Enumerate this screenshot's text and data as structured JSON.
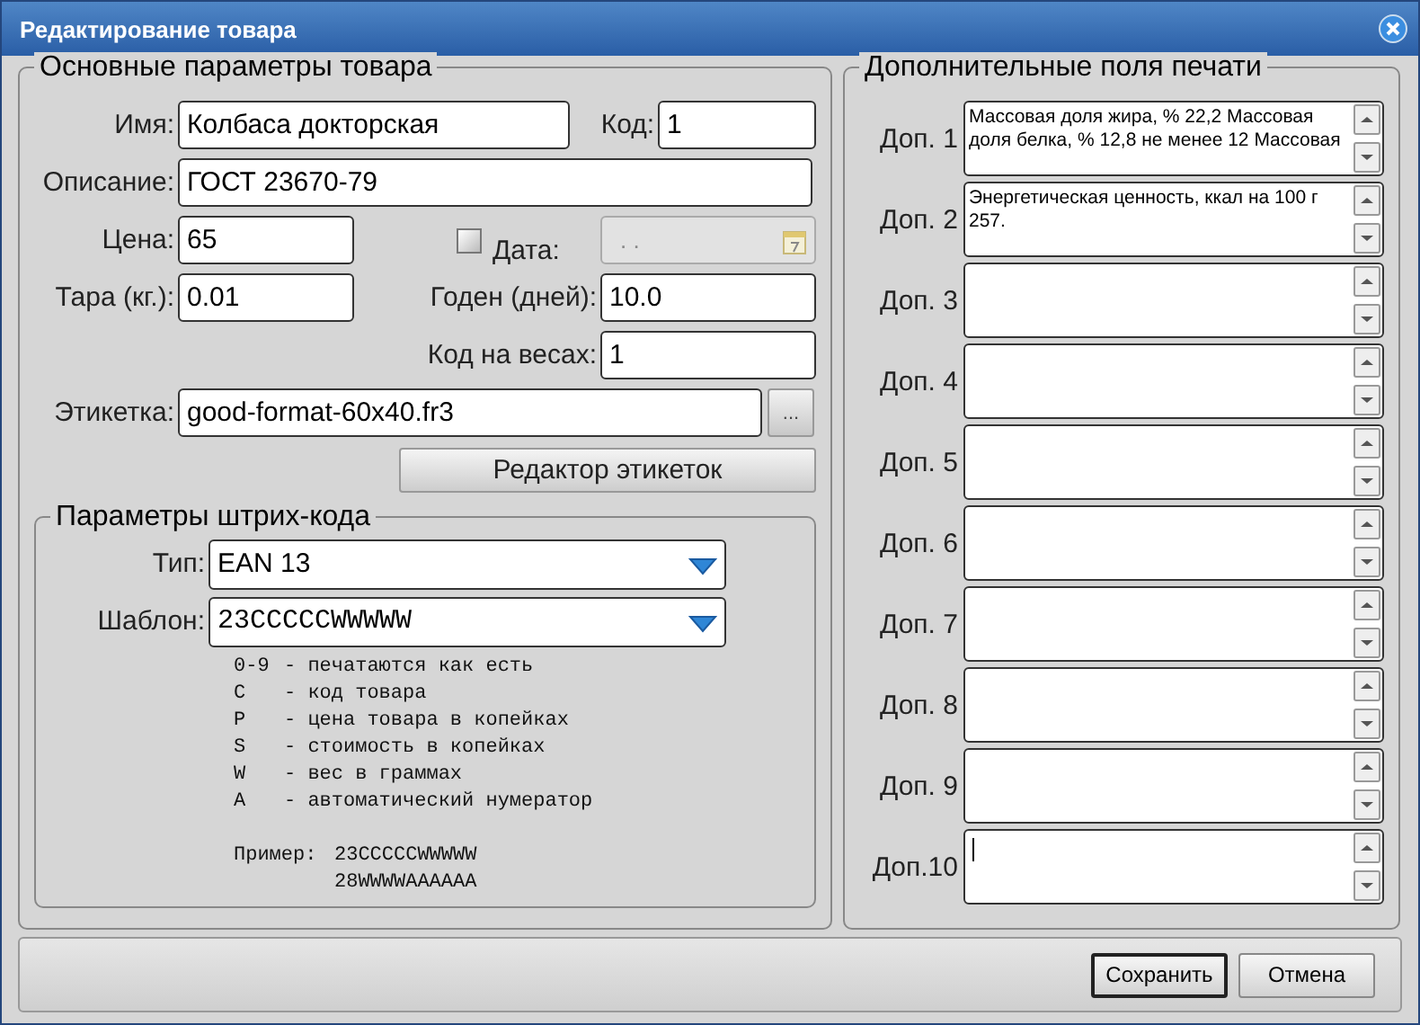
{
  "window": {
    "title": "Редактирование товара"
  },
  "main_group": {
    "title": "Основные параметры товара",
    "name": {
      "label": "Имя:",
      "value": "Колбаса докторская"
    },
    "code": {
      "label": "Код:",
      "value": "1"
    },
    "description": {
      "label": "Описание:",
      "value": "ГОСТ 23670-79"
    },
    "price": {
      "label": "Цена:",
      "value": "65"
    },
    "date": {
      "label": "Дата:",
      "checked": false,
      "value": ". .",
      "disabled": true
    },
    "tare": {
      "label": "Тара (кг.):",
      "value": "0.01"
    },
    "shelf_life": {
      "label": "Годен (дней):",
      "value": "10.0"
    },
    "scale_code": {
      "label": "Код на весах:",
      "value": "1"
    },
    "label_file": {
      "label": "Этикетка:",
      "value": "good-format-60x40.fr3",
      "browse": "..."
    },
    "label_editor_button": "Редактор этикеток"
  },
  "barcode_group": {
    "title": "Параметры штрих-кода",
    "type": {
      "label": "Тип:",
      "value": "EAN 13"
    },
    "template": {
      "label": "Шаблон:",
      "value": "23CCCCCWWWWW"
    },
    "legend": [
      {
        "code": "0-9",
        "text": "- печатаются как есть"
      },
      {
        "code": "C",
        "text": "- код товара"
      },
      {
        "code": "P",
        "text": "- цена товара в копейках"
      },
      {
        "code": "S",
        "text": "- стоимость в копейках"
      },
      {
        "code": "W",
        "text": "- вес в граммах"
      },
      {
        "code": "A",
        "text": "- автоматический нумератор"
      }
    ],
    "example": {
      "label": "Пример:",
      "values": [
        "23CCCCCWWWWW",
        "28WWWWAAAAAA"
      ]
    }
  },
  "extra_group": {
    "title": "Дополнительные поля печати",
    "fields": [
      {
        "label": "Доп. 1",
        "lines": [
          "Массовая доля жира, % 22,2  Массовая",
          "доля белка, % 12,8  не менее 12 Массовая"
        ]
      },
      {
        "label": "Доп. 2",
        "lines": [
          "Энергетическая ценность, ккал на 100 г",
          "257."
        ]
      },
      {
        "label": "Доп. 3"
      },
      {
        "label": "Доп. 4"
      },
      {
        "label": "Доп. 5"
      },
      {
        "label": "Доп. 6"
      },
      {
        "label": "Доп. 7"
      },
      {
        "label": "Доп. 8"
      },
      {
        "label": "Доп. 9"
      },
      {
        "label": "Доп.10",
        "focused": true
      }
    ]
  },
  "buttons": [
    {
      "label": "Сохранить",
      "default": true
    },
    {
      "label": "Отмена",
      "default": false
    }
  ]
}
